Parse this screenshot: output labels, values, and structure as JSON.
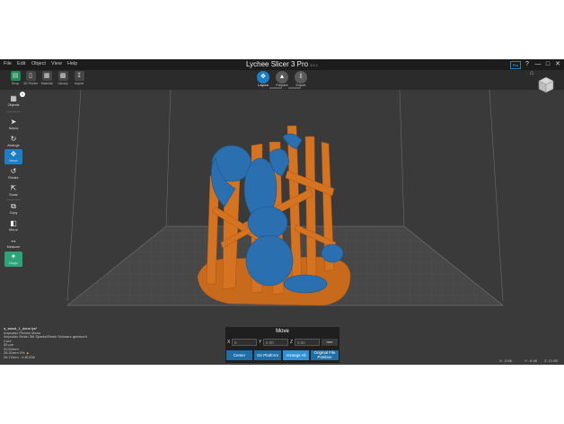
{
  "menu": [
    "File",
    "Edit",
    "Object",
    "View",
    "Help"
  ],
  "app": {
    "title": "Lychee Slicer 3 Pro",
    "version": "3.5.1"
  },
  "titlebar_buttons": [
    "Pro",
    "?",
    "—",
    "□",
    "✕"
  ],
  "toolbar": [
    {
      "icon": "shop-icon",
      "label": "Shop"
    },
    {
      "icon": "3d-printer-icon",
      "label": "3D Printer"
    },
    {
      "icon": "material-icon",
      "label": "Material"
    },
    {
      "icon": "library-icon",
      "label": "Library"
    },
    {
      "icon": "import-icon",
      "label": "Import"
    }
  ],
  "steps": [
    {
      "label": "Layout",
      "active": true
    },
    {
      "label": "Prepare",
      "active": false
    },
    {
      "label": "Export",
      "active": false
    }
  ],
  "left_tools": [
    {
      "name": "objects",
      "label": "Objects",
      "badge": "1"
    },
    {
      "name": "select",
      "label": "Select"
    },
    {
      "name": "rotate-view",
      "label": "Arrange"
    },
    {
      "name": "move",
      "label": "Move",
      "active": true
    },
    {
      "name": "rotate",
      "label": "Rotate"
    },
    {
      "name": "scale",
      "label": "Scale"
    },
    {
      "name": "copy",
      "label": "Copy"
    },
    {
      "name": "mirror",
      "label": "Mirror"
    },
    {
      "name": "measure",
      "label": "Measure"
    },
    {
      "name": "magic",
      "label": "Magic",
      "green": true
    }
  ],
  "info_lines": [
    "a_stand_1_done.lys*",
    "Anycubic Photon Mono",
    "Anycubic Resin 3M Sparks/Resin Schwarz gemischt",
    "Cure",
    "55 µm",
    "20.62mm",
    "26.31mm 0%",
    "26.72mm - 0.81338"
  ],
  "coords": {
    "x": "X: -5.66",
    "y": "Y: -9.98",
    "z": "Z: 21.95"
  },
  "move_panel": {
    "title": "Move",
    "axes": [
      {
        "label": "X",
        "value": "0"
      },
      {
        "label": "Y",
        "value": "0.00"
      },
      {
        "label": "Z",
        "value": "0.00"
      }
    ],
    "unit": "mm",
    "buttons": [
      "Center",
      "On Platform",
      "Arrange All"
    ],
    "original_label": [
      "Original File",
      "Position"
    ]
  },
  "colors": {
    "accent": "#1b7fc4",
    "model": "#2a6fb0",
    "supports": "#d67320",
    "background": "#3a3a3a",
    "build_plate": "#4a4a4a"
  }
}
